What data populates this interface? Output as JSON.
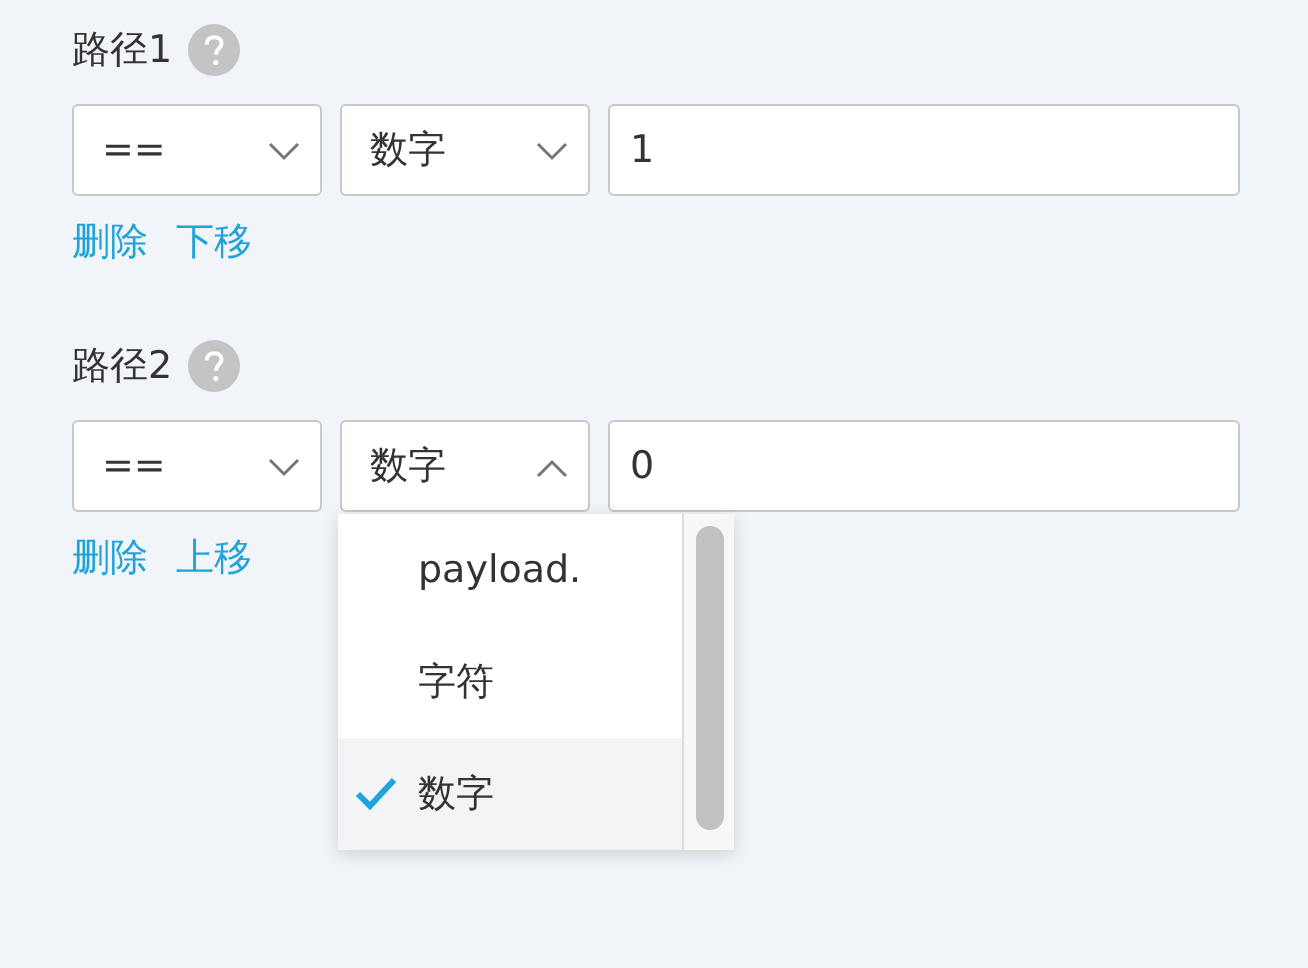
{
  "paths": [
    {
      "label": "路径1",
      "operator": "==",
      "type": "数字",
      "open": false,
      "value": "1",
      "actions": [
        "删除",
        "下移"
      ]
    },
    {
      "label": "路径2",
      "operator": "==",
      "type": "数字",
      "open": true,
      "value": "0",
      "actions": [
        "删除",
        "上移"
      ]
    }
  ],
  "options": [
    {
      "label": "payload.",
      "selected": false
    },
    {
      "label": "字符",
      "selected": false
    },
    {
      "label": "数字",
      "selected": true
    }
  ]
}
